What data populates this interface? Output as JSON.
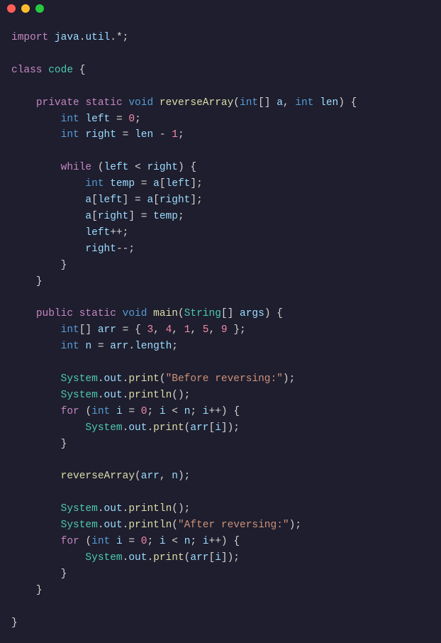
{
  "titlebar": {
    "red": "#ff5f56",
    "yellow": "#ffbd2e",
    "green": "#27c93f"
  },
  "code": {
    "l01_import": "import",
    "l01_java": "java",
    "l01_util": "util",
    "l02_class": "class",
    "l02_code": "code",
    "l04_private": "private",
    "l04_static": "static",
    "l04_void": "void",
    "l04_reverseArray": "reverseArray",
    "l04_int": "int",
    "l04_a": "a",
    "l04_int2": "int",
    "l04_len": "len",
    "l05_int": "int",
    "l05_left": "left",
    "l05_zero": "0",
    "l06_int": "int",
    "l06_right": "right",
    "l06_len": "len",
    "l06_one": "1",
    "l08_while": "while",
    "l08_left": "left",
    "l08_right": "right",
    "l09_int": "int",
    "l09_temp": "temp",
    "l09_a": "a",
    "l09_left": "left",
    "l10_a": "a",
    "l10_left": "left",
    "l10_a2": "a",
    "l10_right": "right",
    "l11_a": "a",
    "l11_right": "right",
    "l11_temp": "temp",
    "l12_left": "left",
    "l13_right": "right",
    "l17_public": "public",
    "l17_static": "static",
    "l17_void": "void",
    "l17_main": "main",
    "l17_String": "String",
    "l17_args": "args",
    "l18_int": "int",
    "l18_arr": "arr",
    "l18_n1": "3",
    "l18_n2": "4",
    "l18_n3": "1",
    "l18_n4": "5",
    "l18_n5": "9",
    "l19_int": "int",
    "l19_n": "n",
    "l19_arr": "arr",
    "l19_length": "length",
    "l21_System": "System",
    "l21_out": "out",
    "l21_print": "print",
    "l21_str": "\"Before reversing:\"",
    "l22_System": "System",
    "l22_out": "out",
    "l22_println": "println",
    "l23_for": "for",
    "l23_int": "int",
    "l23_i": "i",
    "l23_zero": "0",
    "l23_i2": "i",
    "l23_n": "n",
    "l23_i3": "i",
    "l24_System": "System",
    "l24_out": "out",
    "l24_print": "print",
    "l24_arr": "arr",
    "l24_i": "i",
    "l27_reverseArray": "reverseArray",
    "l27_arr": "arr",
    "l27_n": "n",
    "l29_System": "System",
    "l29_out": "out",
    "l29_println": "println",
    "l30_System": "System",
    "l30_out": "out",
    "l30_println": "println",
    "l30_str": "\"After reversing:\"",
    "l31_for": "for",
    "l31_int": "int",
    "l31_i": "i",
    "l31_zero": "0",
    "l31_i2": "i",
    "l31_n": "n",
    "l31_i3": "i",
    "l32_System": "System",
    "l32_out": "out",
    "l32_print": "print",
    "l32_arr": "arr",
    "l32_i": "i"
  }
}
